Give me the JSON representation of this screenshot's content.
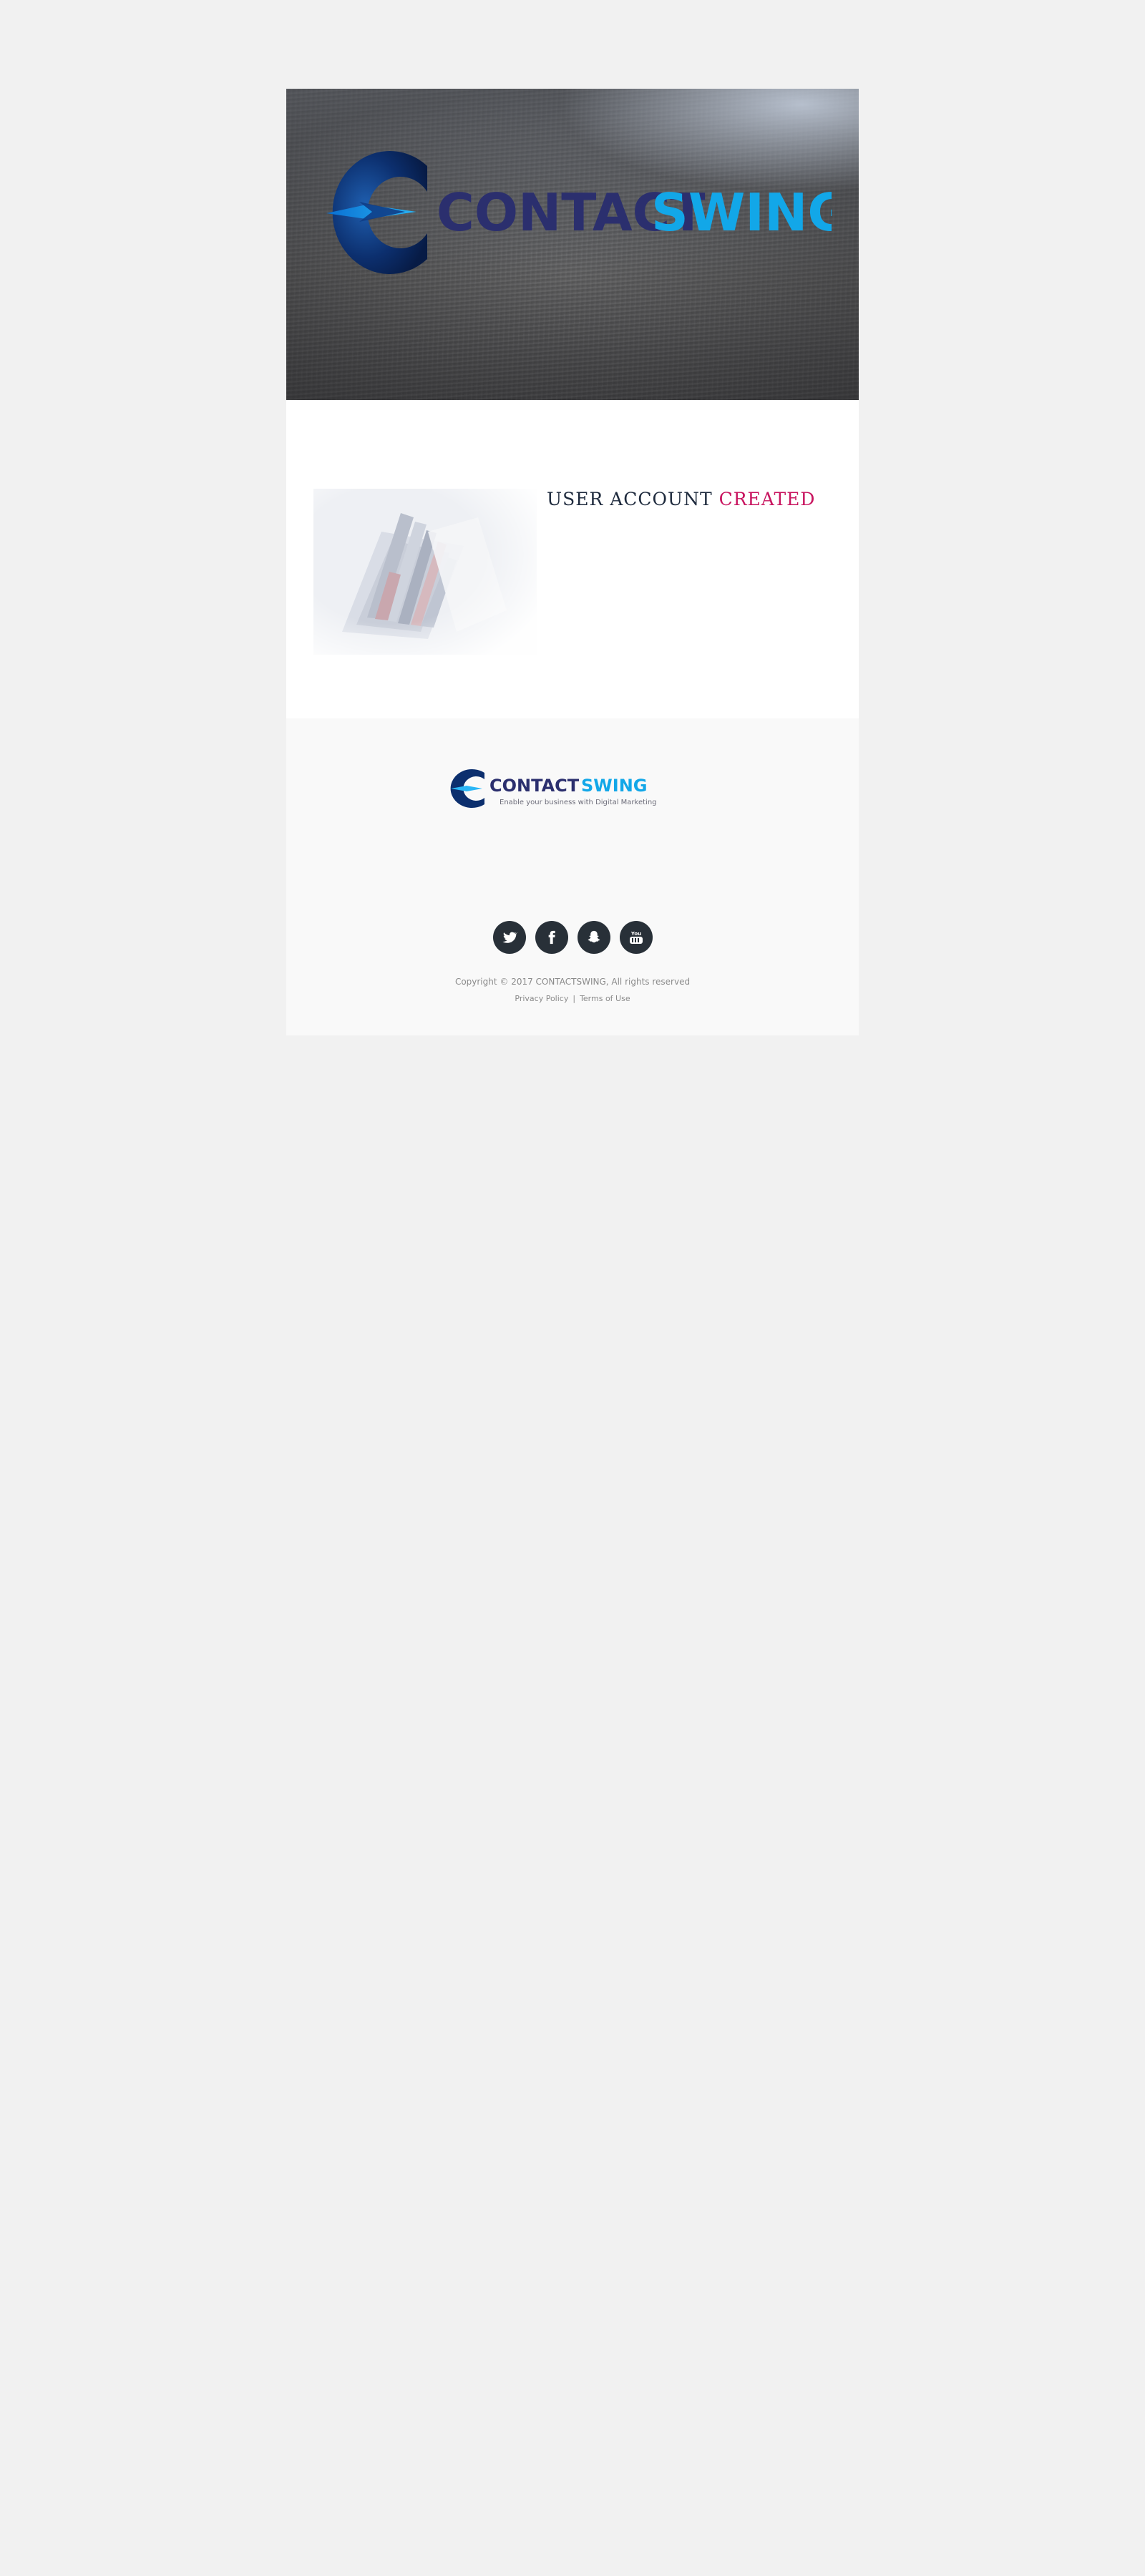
{
  "header": {
    "brand_part1": "CONTACT",
    "brand_part2": "SWING",
    "brand_color_dark": "#2b2f6e",
    "brand_color_light": "#12a7e8"
  },
  "content": {
    "headline_part1": "USER ACCOUNT ",
    "headline_part2": "CREATED",
    "headline_color": "#1e2a3d",
    "accent_color": "#c8145f"
  },
  "footer": {
    "brand_part1": "CONTACT",
    "brand_part2": "SWING",
    "tagline": "Enable your business with Digital Marketing",
    "social": [
      {
        "icon": "twitter-icon"
      },
      {
        "icon": "facebook-icon"
      },
      {
        "icon": "snapchat-icon"
      },
      {
        "icon": "youtube-icon",
        "text": "You"
      }
    ],
    "copyright": "Copyright © 2017 CONTACTSWING, All rights reserved",
    "privacy_label": "Privacy Policy",
    "separator": "|",
    "terms_label": "Terms of Use"
  }
}
